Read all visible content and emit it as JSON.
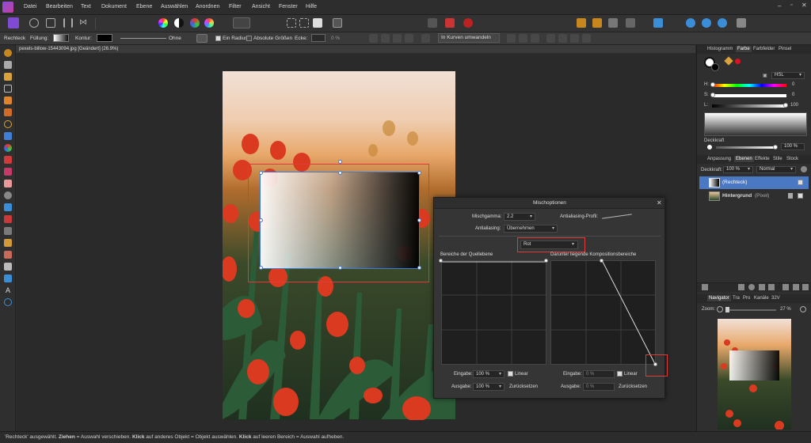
{
  "menubar": {
    "items": [
      "Datei",
      "Bearbeiten",
      "Text",
      "Dokument",
      "Ebene",
      "Auswählen",
      "Anordnen",
      "Filter",
      "Ansicht",
      "Fenster",
      "Hilfe"
    ]
  },
  "context": {
    "tool": "Rechteck",
    "fill_label": "Füllung:",
    "stroke_label": "Kontur:",
    "stroke_none": "Ohne",
    "radius_label": "Ein Radius",
    "absolute_label": "Absolute Größen",
    "corner_label": "Ecke:",
    "corner_value": "0 %",
    "convert_label": "In Kurven umwandeln"
  },
  "document": {
    "tab_title": "pexels-billow-15443094.jpg [Geändert] (26.9%)"
  },
  "dialog": {
    "title": "Mischoptionen",
    "gamma_label": "Mischgamma:",
    "gamma_value": "2.2",
    "aa_profile_label": "Antialiasing-Profil:",
    "aa_label": "Antialiasing:",
    "aa_value": "Übernehmen",
    "channel_value": "Rot",
    "source_label": "Bereiche der Quellebene",
    "dest_label": "Darunter liegende Kompositionsbereiche",
    "input_label": "Eingabe:",
    "output_label": "Ausgabe:",
    "source_input": "100 %",
    "source_output": "100 %",
    "dest_input": "0 %",
    "dest_output": "0 %",
    "linear_label": "Linear",
    "reset_label": "Zurücksetzen"
  },
  "panels": {
    "top_tabs": [
      "Histogramm",
      "Farbe",
      "Farbfelder",
      "Pinsel"
    ],
    "color_mode": "HSL",
    "h_label": "H:",
    "h_value": "0",
    "s_label": "S:",
    "s_value": "0",
    "l_label": "L:",
    "l_value": "100",
    "opacity_label": "Deckkraft",
    "opacity_value": "100 %",
    "mid_tabs": [
      "Anpassung",
      "Ebenen",
      "Effekte",
      "Stile",
      "Stock"
    ],
    "layer_opacity_label": "Deckkraft:",
    "layer_opacity_value": "100 %",
    "blend_mode": "Normal",
    "layers": [
      {
        "name": "(Rechteck)",
        "selected": true
      },
      {
        "name": "Hintergrund",
        "type": "(Pixel)",
        "selected": false
      }
    ],
    "nav_tabs": [
      "Navigator",
      "Tra",
      "Pro",
      "Kanäle",
      "32V"
    ],
    "zoom_label": "Zoom:",
    "zoom_value": "27 %"
  },
  "status": {
    "part1": "'Rechteck' ausgewählt. ",
    "b1": "Ziehen",
    "part2": " = Auswahl verschieben. ",
    "b2": "Klick",
    "part3": " auf anderes Objekt = Objekt auswählen. ",
    "b3": "Klick",
    "part4": " auf leeren Bereich = Auswahl aufheben."
  },
  "colors": {
    "accent_red": "#e03a3a",
    "selection_blue": "#3d7bd9",
    "layer_selected": "#4a78c2"
  }
}
